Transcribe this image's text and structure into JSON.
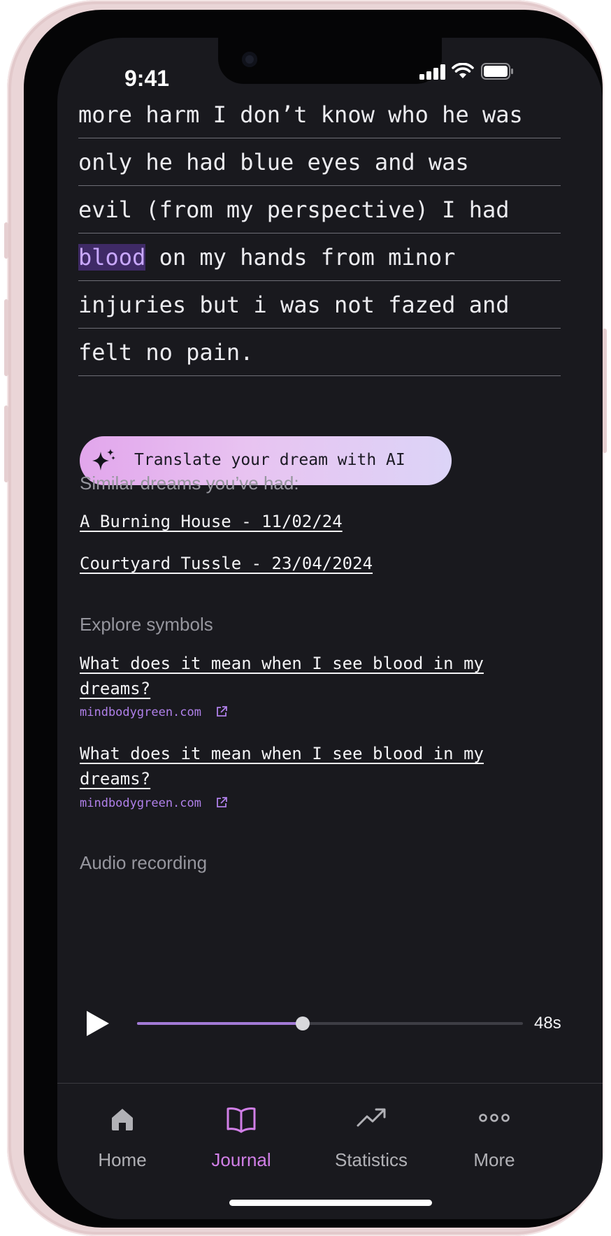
{
  "status_bar": {
    "time": "9:41"
  },
  "dream_text": {
    "lines": [
      "more harm I don’t know who he was",
      "only he had blue eyes and was",
      "evil (from my perspective) I had",
      "on my hands from minor",
      "injuries but i was not fazed and",
      "felt no pain."
    ],
    "highlighted_word": "blood"
  },
  "ai_button": {
    "label": "Translate your dream with AI",
    "icon": "sparkles-icon"
  },
  "similar_dreams": {
    "heading": "Similar dreams you’ve had:",
    "items": [
      "A Burning House - 11/02/24",
      "Courtyard Tussle - 23/04/2024"
    ]
  },
  "explore_symbols": {
    "heading": "Explore symbols",
    "articles": [
      {
        "title": "What does it mean when I see blood in my dreams?",
        "source": "mindbodygreen.com",
        "icon": "external-link-icon"
      },
      {
        "title": "What does it mean when I see blood in my dreams?",
        "source": "mindbodygreen.com",
        "icon": "external-link-icon"
      }
    ]
  },
  "audio": {
    "heading": "Audio recording",
    "duration": "48s",
    "progress": 0.43,
    "play_icon": "play-icon"
  },
  "tab_bar": {
    "active": "Journal",
    "accent_color": "#d17fe7",
    "tabs": [
      {
        "label": "Home",
        "icon": "home-icon"
      },
      {
        "label": "Journal",
        "icon": "book-icon"
      },
      {
        "label": "Statistics",
        "icon": "trending-up-icon"
      },
      {
        "label": "More",
        "icon": "more-dots-icon"
      }
    ]
  }
}
